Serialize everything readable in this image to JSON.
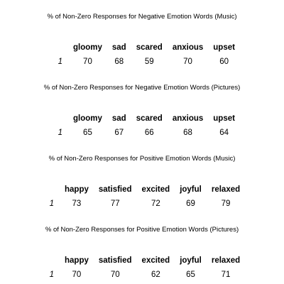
{
  "tables": [
    {
      "caption": "% of Non-Zero Responses for Negative Emotion Words (Music)",
      "headers": [
        "gloomy",
        "sad",
        "scared",
        "anxious",
        "upset"
      ],
      "row_label": "1",
      "values": [
        "70",
        "68",
        "59",
        "70",
        "60"
      ]
    },
    {
      "caption": "% of Non-Zero Responses for Negative Emotion Words (Pictures)",
      "headers": [
        "gloomy",
        "sad",
        "scared",
        "anxious",
        "upset"
      ],
      "row_label": "1",
      "values": [
        "65",
        "67",
        "66",
        "68",
        "64"
      ]
    },
    {
      "caption": "% of Non-Zero Responses for Positive Emotion Words (Music)",
      "headers": [
        "happy",
        "satisfied",
        "excited",
        "joyful",
        "relaxed"
      ],
      "row_label": "1",
      "values": [
        "73",
        "77",
        "72",
        "69",
        "79"
      ]
    },
    {
      "caption": "% of Non-Zero Responses for Positive Emotion Words (Pictures)",
      "headers": [
        "happy",
        "satisfied",
        "excited",
        "joyful",
        "relaxed"
      ],
      "row_label": "1",
      "values": [
        "70",
        "70",
        "62",
        "65",
        "71"
      ]
    }
  ]
}
